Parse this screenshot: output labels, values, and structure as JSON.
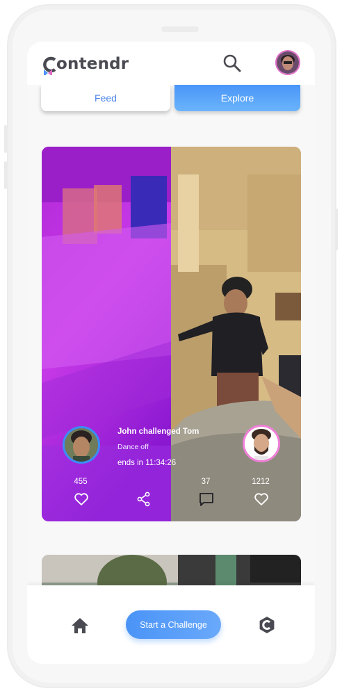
{
  "app": {
    "name": "Contendr"
  },
  "header": {
    "logo_text": "ontendr",
    "search_icon": "search-icon",
    "avatar_label": "profile avatar"
  },
  "tabs": [
    {
      "label": "Feed",
      "active": false
    },
    {
      "label": "Explore",
      "active": true
    }
  ],
  "challenge": {
    "title": "John challenged Tom",
    "category": "Dance off",
    "ends_label": "ends in",
    "ends_time": "11:34:26",
    "challenger_likes": "455",
    "comments": "37",
    "opponent_likes": "1212"
  },
  "bottom_nav": {
    "home_icon": "home-icon",
    "cta_label": "Start a Challenge",
    "brand_icon": "contendr-logo-icon"
  },
  "colors": {
    "accent": "#4a94f7",
    "brand_pink": "#e06cc7",
    "text_dark": "#4a4a52"
  }
}
